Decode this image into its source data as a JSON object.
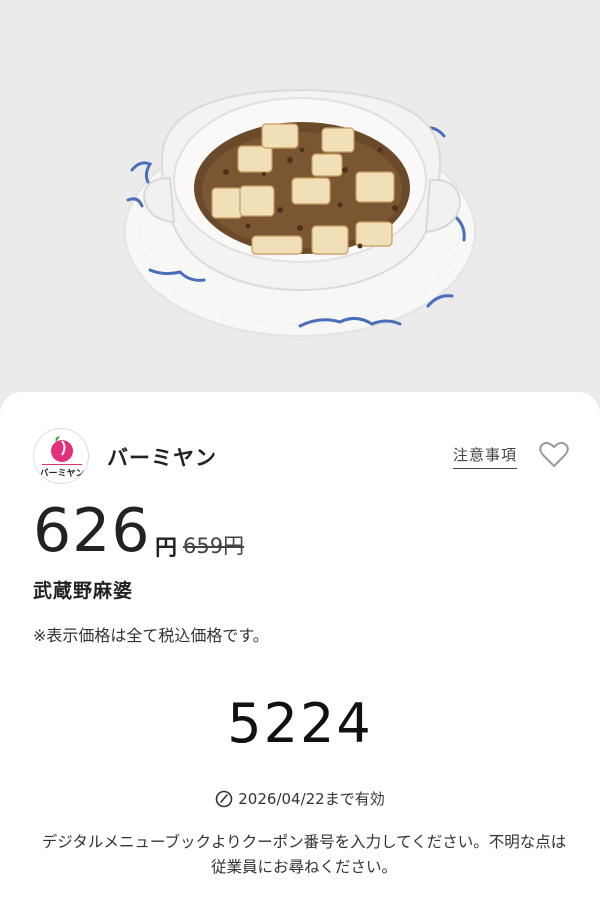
{
  "product_image": {
    "subject": "mapo-tofu-in-clay-bowl"
  },
  "brand": {
    "name": "バーミヤン",
    "logo_text": "バーミヤン",
    "logo_color": "#e2317a"
  },
  "header": {
    "notice_link": "注意事項"
  },
  "price": {
    "current": "626",
    "unit": "円",
    "original": "659円"
  },
  "product": {
    "name": "武蔵野麻婆"
  },
  "tax_note": "※表示価格は全て税込価格です。",
  "coupon": {
    "code": "5224"
  },
  "validity": {
    "text": "2026/04/22まで有効"
  },
  "instructions": "デジタルメニューブックよりクーポン番号を入力してください。不明な点は従業員にお尋ねください。",
  "colors": {
    "accent": "#e2317a",
    "background": "#ebebeb"
  }
}
